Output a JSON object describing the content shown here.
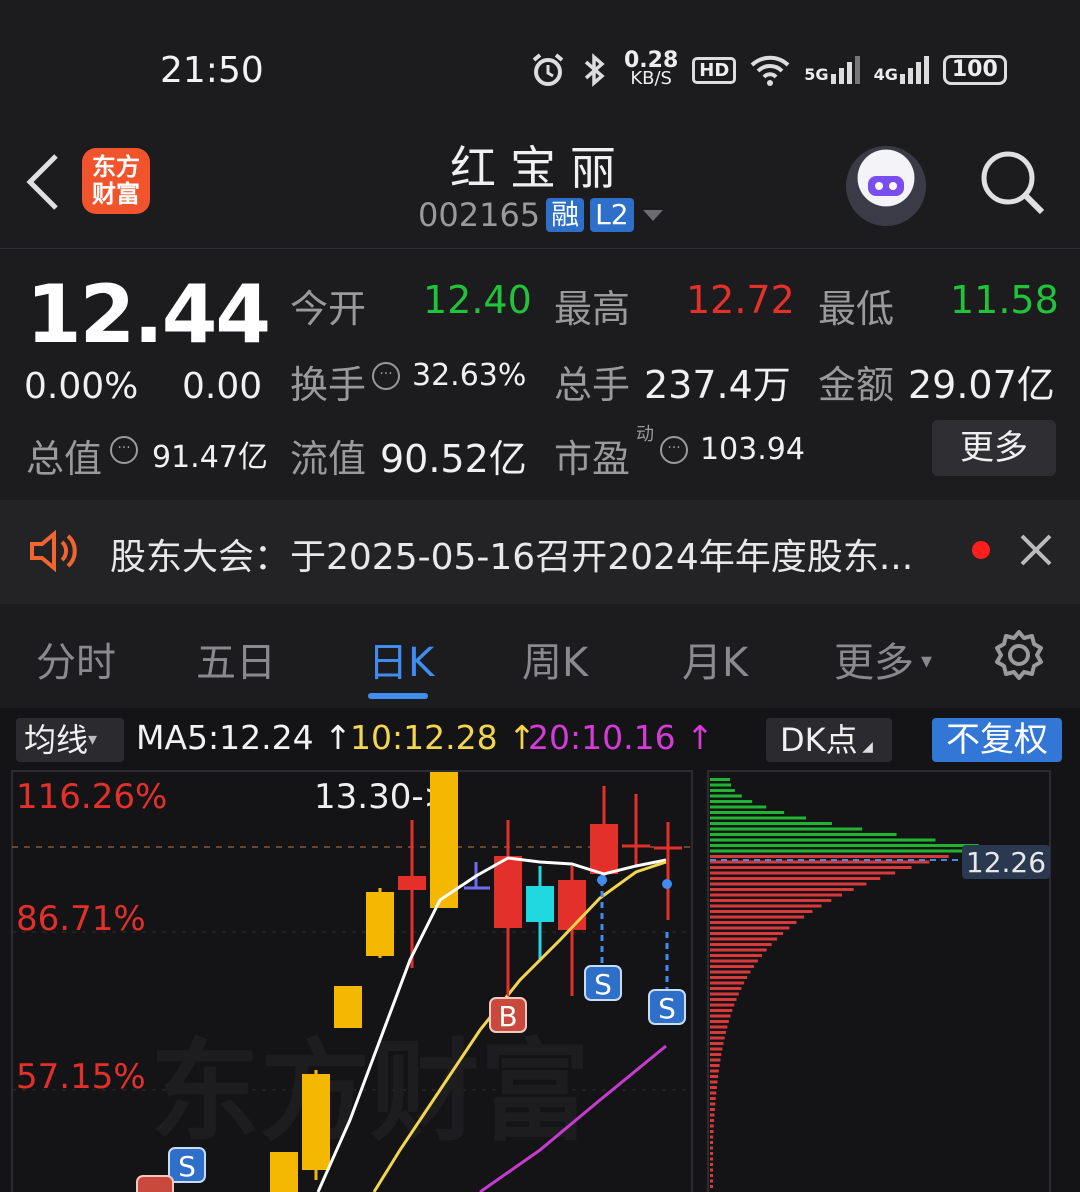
{
  "status_bar": {
    "time": "21:50",
    "net_speed": "0.28",
    "net_unit": "KB/S",
    "hd": "HD",
    "net5g": "5G",
    "net4g": "4G",
    "battery": "100"
  },
  "header": {
    "brand": "东方财富",
    "stock_name": "红宝丽",
    "code": "002165",
    "tag_margin": "融",
    "tag_l2": "L2"
  },
  "quote": {
    "price": "12.44",
    "change_pct": "0.00%",
    "change": "0.00",
    "open_label": "今开",
    "open": "12.40",
    "high_label": "最高",
    "high": "12.72",
    "low_label": "最低",
    "low": "11.58",
    "turnover_label": "换手",
    "turnover": "32.63%",
    "volume_label": "总手",
    "volume": "237.4万",
    "amount_label": "金额",
    "amount": "29.07亿",
    "total_mv_label": "总值",
    "total_mv": "91.47亿",
    "float_mv_label": "流值",
    "float_mv": "90.52亿",
    "pe_label": "市盈",
    "pe_sup": "动",
    "pe": "103.94",
    "more_label": "更多"
  },
  "notice": {
    "text": "股东大会：于2025-05-16召开2024年年度股东..."
  },
  "tabs": [
    "分时",
    "五日",
    "日K",
    "周K",
    "月K",
    "更多"
  ],
  "chart": {
    "ma_button": "均线",
    "ma5": "MA5:12.24",
    "ma10": "10:12.28",
    "ma20": "20:10.16",
    "dk_button": "DK点",
    "fq_button": "不复权",
    "pct_labels": [
      "116.26%",
      "86.71%",
      "57.15%"
    ],
    "max_label": "13.30->",
    "watermark": "东方财富",
    "chip_price": "12.26",
    "colors": {
      "up": "#e4302b",
      "down": "#22d8e0",
      "yang": "#f5b800",
      "ma5": "#ffffff",
      "ma10": "#f3d64e",
      "ma20": "#c83bd0"
    }
  }
}
